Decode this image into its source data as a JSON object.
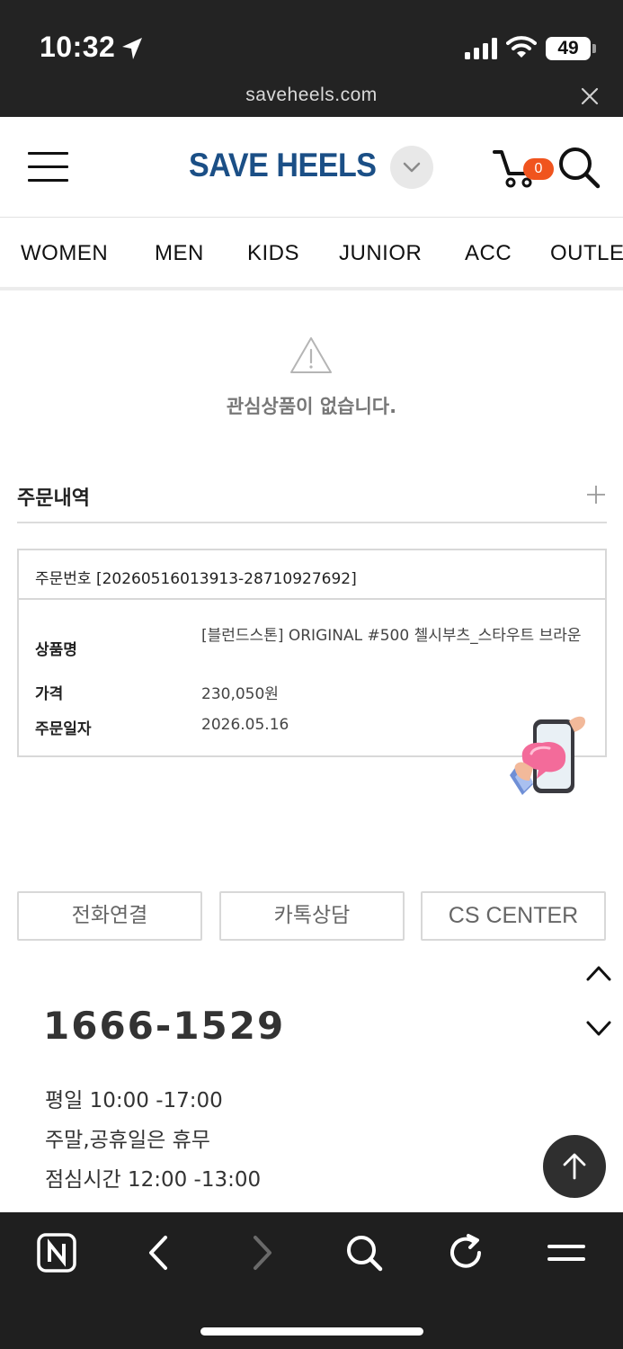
{
  "status_bar": {
    "time": "10:32",
    "battery": "49",
    "url": "saveheels.com",
    "location_icon": "location-arrow-icon",
    "close_icon": "close-icon"
  },
  "header": {
    "logo": "SAVE HEELS",
    "cart_count": "0",
    "brand_color": "#1b4f86",
    "badge_color": "#f0541e"
  },
  "nav": {
    "categories": [
      "WOMEN",
      "MEN",
      "KIDS",
      "JUNIOR",
      "ACC",
      "OUTLET"
    ]
  },
  "wishlist": {
    "empty_message": "관심상품이 없습니다."
  },
  "orders": {
    "title": "주문내역",
    "order_number": "주문번호 [20260516013913-28710927692]",
    "rows": [
      {
        "label": "상품명",
        "value": "[블런드스톤] ORIGINAL #500 첼시부츠_스타우트 브라운"
      },
      {
        "label": "가격",
        "value": "230,050원"
      },
      {
        "label": "주문일자",
        "value": "2026.05.16"
      }
    ]
  },
  "actions": {
    "call": "전화연결",
    "kakao": "카톡상담",
    "cs_center": "CS CENTER"
  },
  "cs_info": {
    "phone": "1666-1529",
    "hours": [
      "평일 10:00 -17:00",
      "주말,공휴일은 휴무",
      "점심시간 12:00 -13:00"
    ]
  },
  "toolbar": {
    "icons": [
      "naver-n-icon",
      "back-icon",
      "forward-icon",
      "search-icon",
      "reload-icon",
      "menu-icon"
    ]
  }
}
